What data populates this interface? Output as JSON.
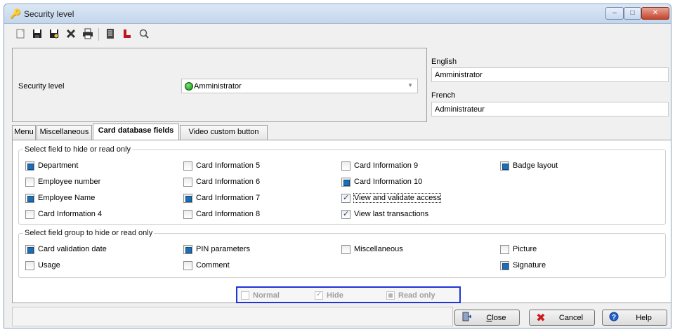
{
  "window": {
    "title": "Security level",
    "controls": {
      "minimize": "‒",
      "maximize": "□",
      "close": "✕"
    }
  },
  "toolbar": {
    "icons": [
      "new-icon",
      "save-icon",
      "save-as-icon",
      "delete-icon",
      "print-icon",
      "list-icon",
      "phone-icon",
      "search-icon"
    ]
  },
  "security": {
    "label": "Security level",
    "selected": "Amministrator"
  },
  "languages": {
    "english_label": "English",
    "english_value": "Amministrator",
    "french_label": "French",
    "french_value": "Administrateur"
  },
  "tabs": [
    "Menu",
    "Miscellaneous",
    "Card database fields",
    "Video custom button"
  ],
  "active_tab": "Card database fields",
  "fields_group": {
    "legend": "Select field to hide or read only",
    "items": [
      {
        "label": "Department",
        "state": "read_only"
      },
      {
        "label": "Employee number",
        "state": "normal"
      },
      {
        "label": "Employee Name",
        "state": "read_only"
      },
      {
        "label": "Card Information 4",
        "state": "normal"
      },
      {
        "label": "Card Information 5",
        "state": "normal"
      },
      {
        "label": "Card Information 6",
        "state": "normal"
      },
      {
        "label": "Card Information 7",
        "state": "read_only"
      },
      {
        "label": "Card Information 8",
        "state": "normal"
      },
      {
        "label": "Card Information 9",
        "state": "normal"
      },
      {
        "label": "Card Information 10",
        "state": "read_only"
      },
      {
        "label": "View and validate access",
        "state": "hide"
      },
      {
        "label": "View last transactions",
        "state": "hide"
      },
      {
        "label": "Badge layout",
        "state": "read_only"
      }
    ]
  },
  "groups_group": {
    "legend": "Select field group to hide or read only",
    "items": [
      {
        "label": "Card validation date",
        "state": "read_only"
      },
      {
        "label": "Usage",
        "state": "normal"
      },
      {
        "label": "PIN parameters",
        "state": "read_only"
      },
      {
        "label": "Comment",
        "state": "normal"
      },
      {
        "label": "Miscellaneous",
        "state": "normal"
      },
      {
        "label": "Picture",
        "state": "normal"
      },
      {
        "label": "Signature",
        "state": "read_only"
      }
    ]
  },
  "state_legend": {
    "normal": "Normal",
    "hide": "Hide",
    "read_only": "Read only"
  },
  "buttons": {
    "close": {
      "label": "Close",
      "accel": "C",
      "rest": "lose"
    },
    "cancel": {
      "label": "Cancel"
    },
    "help": {
      "label": "Help"
    }
  },
  "colors": {
    "accent_blue": "#1f35d9",
    "readonly_fill": "#1c6eb6",
    "cancel_red": "#d0151b"
  }
}
